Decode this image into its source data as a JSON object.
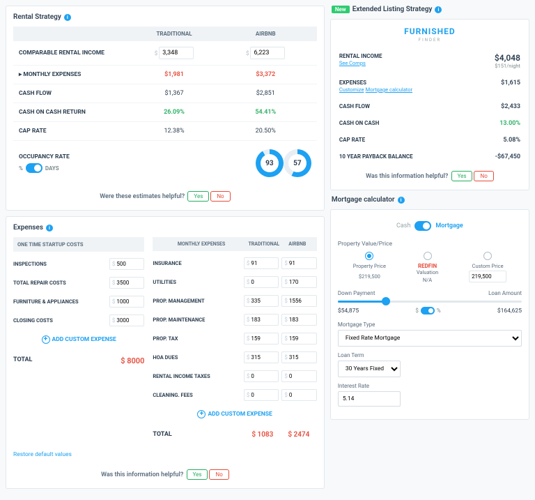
{
  "rental": {
    "title": "Rental Strategy",
    "head_trad": "TRADITIONAL",
    "head_airbnb": "AIRBNB",
    "rows": {
      "income": {
        "label": "COMPARABLE RENTAL INCOME",
        "trad": "3,348",
        "air": "6,223"
      },
      "mexp": {
        "label": "▸ MONTHLY EXPENSES",
        "trad": "$1,981",
        "air": "$3,372"
      },
      "cf": {
        "label": "CASH FLOW",
        "trad": "$1,367",
        "air": "$2,851"
      },
      "cocr": {
        "label": "CASH ON CASH RETURN",
        "trad": "26.09%",
        "air": "54.41%"
      },
      "cap": {
        "label": "CAP RATE",
        "trad": "12.38%",
        "air": "20.50%"
      }
    },
    "occ": {
      "label": "OCCUPANCY RATE",
      "pct": "%",
      "days": "Days",
      "v1": "93",
      "v2": "57"
    },
    "fb": "Were these estimates helpful?",
    "yes": "Yes",
    "no": "No"
  },
  "extended": {
    "new": "New",
    "title": "Extended Listing Strategy",
    "logo1": "FURNISHED",
    "logo2": "FINDER",
    "rows": {
      "ri": {
        "l": "RENTAL INCOME",
        "v": "$4,048",
        "link": "See Comps",
        "sub": "$151/night"
      },
      "ex": {
        "l": "EXPENSES",
        "v": "$1,615",
        "link1": "Customize",
        "link2": "Mortgage calculator"
      },
      "cf": {
        "l": "CASH FLOW",
        "v": "$2,433"
      },
      "coc": {
        "l": "CASH ON CASH",
        "v": "13.00%"
      },
      "cap": {
        "l": "CAP RATE",
        "v": "5.08%"
      },
      "pb": {
        "l": "10 YEAR PAYBACK BALANCE",
        "v": "-$67,450"
      }
    },
    "fb": "Was this information helpful?"
  },
  "exp": {
    "title": "Expenses",
    "startup": {
      "head": "ONE TIME STARTUP COSTS",
      "insp": {
        "l": "INSPECTIONS",
        "v": "500"
      },
      "rep": {
        "l": "TOTAL REPAIR COSTS",
        "v": "3500"
      },
      "furn": {
        "l": "FURNITURE & APPLIANCES",
        "v": "1000"
      },
      "close": {
        "l": "CLOSING COSTS",
        "v": "3000"
      },
      "add": "ADD CUSTOM EXPENSE",
      "total": "TOTAL",
      "totalv": "$ 8000"
    },
    "monthly": {
      "head": "MONTHLY EXPENSES",
      "trad": "TRADITIONAL",
      "air": "AIRBNB",
      "ins": {
        "l": "INSURANCE",
        "t": "91",
        "a": "91"
      },
      "util": {
        "l": "UTILITIES",
        "t": "0",
        "a": "170"
      },
      "pm": {
        "l": "PROP. MANAGEMENT",
        "t": "335",
        "a": "1556"
      },
      "maint": {
        "l": "PROP. MAINTENANCE",
        "t": "183",
        "a": "183"
      },
      "tax": {
        "l": "PROP. TAX",
        "t": "159",
        "a": "159"
      },
      "hoa": {
        "l": "HOA DUES",
        "t": "315",
        "a": "315"
      },
      "rit": {
        "l": "RENTAL INCOME TAXES",
        "t": "0",
        "a": "0"
      },
      "clean": {
        "l": "CLEANING. FEES",
        "t": "0",
        "a": "0"
      },
      "add": "ADD CUSTOM EXPENSE",
      "total": "TOTAL",
      "tt": "$ 1083",
      "ta": "$ 2474"
    },
    "restore": "Restore default values",
    "fb": "Was this information helpful?"
  },
  "mc": {
    "title": "Mortgage calculator",
    "cash": "Cash",
    "mort": "Mortgage",
    "pvp": "Property Value/Price",
    "r1": "Property Price",
    "r1v": "$219,500",
    "r2": "REDFIN",
    "r2b": "Valuation",
    "r2v": "N/A",
    "r3": "Custom Price",
    "r3v": "219,500",
    "dp": "Down Payment",
    "la": "Loan Amount",
    "dpv": "$54,875",
    "lav": "$164,625",
    "dol": "$",
    "pct": "%",
    "mt": "Mortgage Type",
    "mtv": "Fixed Rate Mortgage",
    "lt": "Loan Term",
    "ltv": "30 Years Fixed",
    "ir": "Interest Rate",
    "irv": "5.14"
  },
  "dollar": "$"
}
